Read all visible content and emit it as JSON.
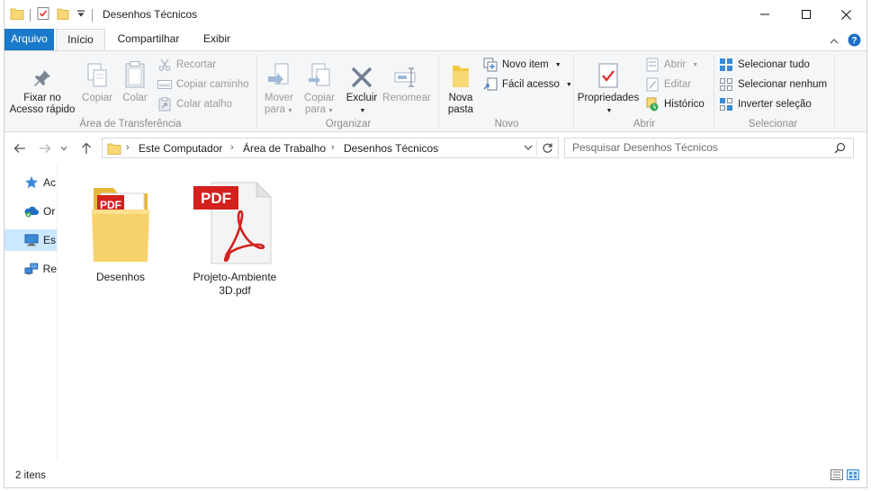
{
  "window": {
    "title": "Desenhos Técnicos",
    "qat_icons": [
      "folder-icon",
      "properties-check-icon",
      "new-folder-icon",
      "customize-qat-icon"
    ]
  },
  "tabs": [
    {
      "label": "Arquivo"
    },
    {
      "label": "Início"
    },
    {
      "label": "Compartilhar"
    },
    {
      "label": "Exibir"
    }
  ],
  "ribbon": {
    "clipboard": {
      "label": "Área de Transferência",
      "pin": "Fixar no\nAcesso rápido",
      "pin_l1": "Fixar no",
      "pin_l2": "Acesso rápido",
      "copy": "Copiar",
      "paste": "Colar",
      "cut": "Recortar",
      "copy_path": "Copiar caminho",
      "paste_shortcut": "Colar atalho"
    },
    "organize": {
      "label": "Organizar",
      "move_l1": "Mover",
      "move_l2": "para",
      "copy_l1": "Copiar",
      "copy_l2": "para",
      "delete": "Excluir",
      "rename": "Renomear"
    },
    "new": {
      "label": "Novo",
      "new_folder_l1": "Nova",
      "new_folder_l2": "pasta",
      "new_item": "Novo item",
      "easy_access": "Fácil acesso"
    },
    "open": {
      "label": "Abrir",
      "properties": "Propriedades",
      "open": "Abrir",
      "edit": "Editar",
      "history": "Histórico"
    },
    "select": {
      "label": "Selecionar",
      "select_all": "Selecionar tudo",
      "select_none": "Selecionar nenhum",
      "invert": "Inverter seleção"
    }
  },
  "address": {
    "crumbs": [
      "Este Computador",
      "Área de Trabalho",
      "Desenhos Técnicos"
    ]
  },
  "search": {
    "placeholder": "Pesquisar Desenhos Técnicos"
  },
  "navpane": {
    "items": [
      {
        "label": "Ac",
        "icon": "quick-access-star-icon"
      },
      {
        "label": "Or",
        "icon": "onedrive-icon"
      },
      {
        "label": "Es",
        "icon": "this-pc-icon",
        "selected": true
      },
      {
        "label": "Re",
        "icon": "network-icon"
      }
    ]
  },
  "files": [
    {
      "name": "Desenhos",
      "type": "folder",
      "badge": "PDF"
    },
    {
      "name": "Projeto-Ambiente 3D.pdf",
      "name_l1": "Projeto-Ambiente",
      "name_l2": "3D.pdf",
      "type": "pdf",
      "badge": "PDF"
    }
  ],
  "status": {
    "count": "2 itens"
  },
  "colors": {
    "file_tab": "#1979ca",
    "selection": "#cce8ff",
    "pdf_red": "#d3211d"
  }
}
